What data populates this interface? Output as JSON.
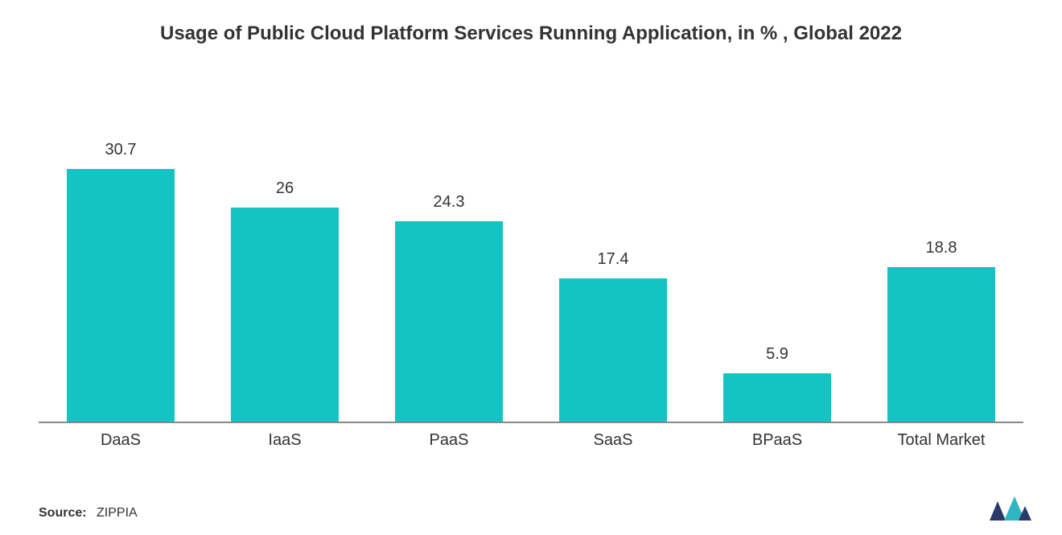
{
  "chart_data": {
    "type": "bar",
    "title": "Usage of Public Cloud Platform Services Running Application, in % , Global 2022",
    "categories": [
      "DaaS",
      "IaaS",
      "PaaS",
      "SaaS",
      "BPaaS",
      "Total Market"
    ],
    "values": [
      30.7,
      26,
      24.3,
      17.4,
      5.9,
      18.8
    ],
    "xlabel": "",
    "ylabel": "",
    "ylim": [
      0,
      35
    ],
    "bar_color": "#14c4c4"
  },
  "footer": {
    "source_label": "Source:",
    "source_value": "ZIPPIA"
  },
  "logo": {
    "name": "mordor-intelligence-logo"
  }
}
